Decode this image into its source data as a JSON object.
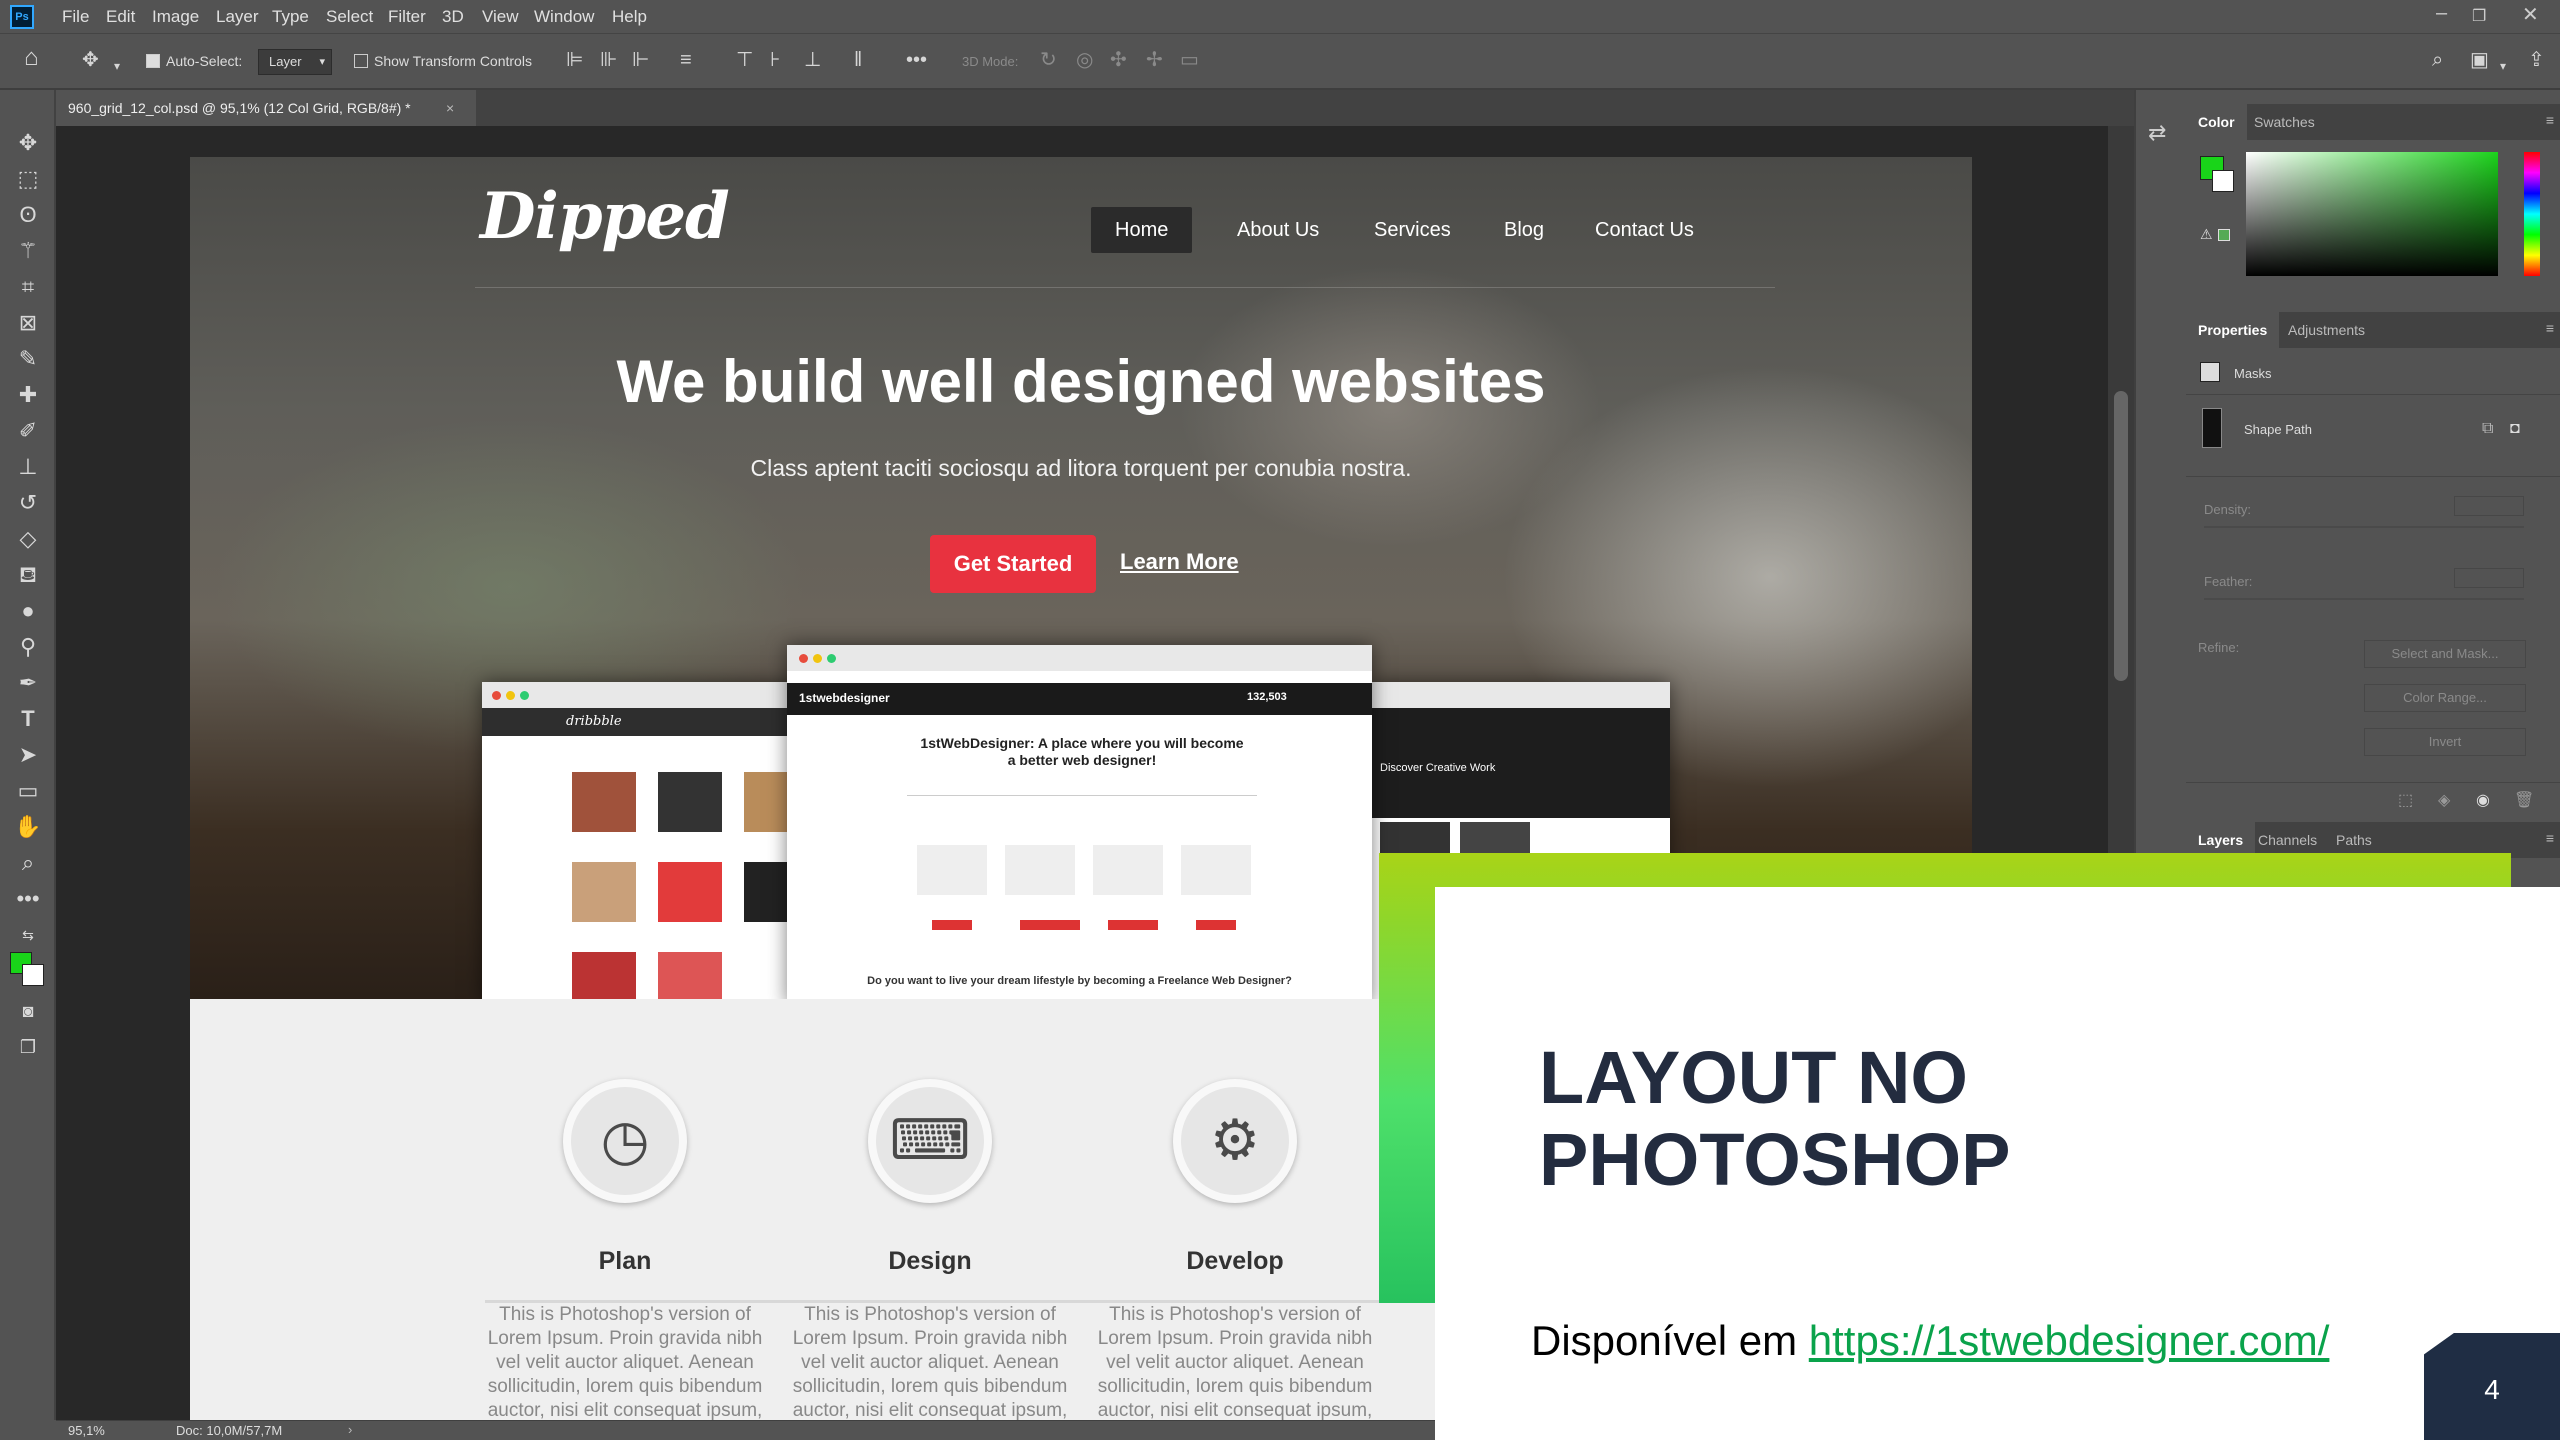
{
  "menubar": {
    "logo": "Ps",
    "items": [
      "File",
      "Edit",
      "Image",
      "Layer",
      "Type",
      "Select",
      "Filter",
      "3D",
      "View",
      "Window",
      "Help"
    ]
  },
  "options": {
    "auto_select_label": "Auto-Select:",
    "auto_select_value": "Layer",
    "transform_label": "Show Transform Controls",
    "mode_label": "3D Mode:"
  },
  "document": {
    "tab_title": "960_grid_12_col.psd @ 95,1% (12 Col Grid, RGB/8#) *",
    "close": "×"
  },
  "site": {
    "logo": "Dipped",
    "nav": [
      "Home",
      "About Us",
      "Services",
      "Blog",
      "Contact Us"
    ],
    "headline": "We build well designed websites",
    "subheadline": "Class aptent taciti sociosqu ad litora torquent per conubia nostra.",
    "cta_primary": "Get Started",
    "cta_secondary": "Learn More",
    "mock_center_title": "1stWebDesigner: A place where you will become a better web designer!",
    "mock_center_brand": "1stwebdesigner",
    "mock_center_count": "132,503",
    "mock_center_question": "Do you want to live your dream lifestyle by becoming a Freelance Web Designer?",
    "mock_right_title": "Discover Creative Work",
    "mock_left_brand": "dribbble",
    "features": [
      {
        "title": "Plan",
        "icon": "clock-icon",
        "text": "This is Photoshop's version  of Lorem Ipsum. Proin gravida nibh vel velit auctor aliquet. Aenean sollicitudin, lorem quis bibendum auctor, nisi elit consequat ipsum,"
      },
      {
        "title": "Design",
        "icon": "laptop-icon",
        "text": "This is Photoshop's version  of Lorem Ipsum. Proin gravida nibh vel velit auctor aliquet. Aenean sollicitudin, lorem quis bibendum auctor, nisi elit consequat ipsum,"
      },
      {
        "title": "Develop",
        "icon": "gear-icon",
        "text": "This is Photoshop's version  of Lorem Ipsum. Proin gravida nibh vel velit auctor aliquet. Aenean sollicitudin, lorem quis bibendum auctor, nisi elit consequat ipsum,"
      }
    ]
  },
  "panels": {
    "color_tabs": [
      "Color",
      "Swatches"
    ],
    "props_tabs": [
      "Properties",
      "Adjustments"
    ],
    "masks_label": "Masks",
    "shape_path": "Shape Path",
    "density": "Density:",
    "feather": "Feather:",
    "refine": "Refine:",
    "btn_select_mask": "Select and Mask...",
    "btn_color_range": "Color Range...",
    "btn_invert": "Invert",
    "layers_tabs": [
      "Layers",
      "Channels",
      "Paths"
    ],
    "fg_color": "#19d419",
    "bg_color": "#ffffff"
  },
  "status": {
    "zoom": "95,1%",
    "doc": "Doc: 10,0M/57,7M"
  },
  "slide": {
    "title": "LAYOUT NO PHOTOSHOP",
    "source_prefix": "Disponível em ",
    "source_link": "https://1stwebdesigner.com/",
    "page_number": "4"
  }
}
